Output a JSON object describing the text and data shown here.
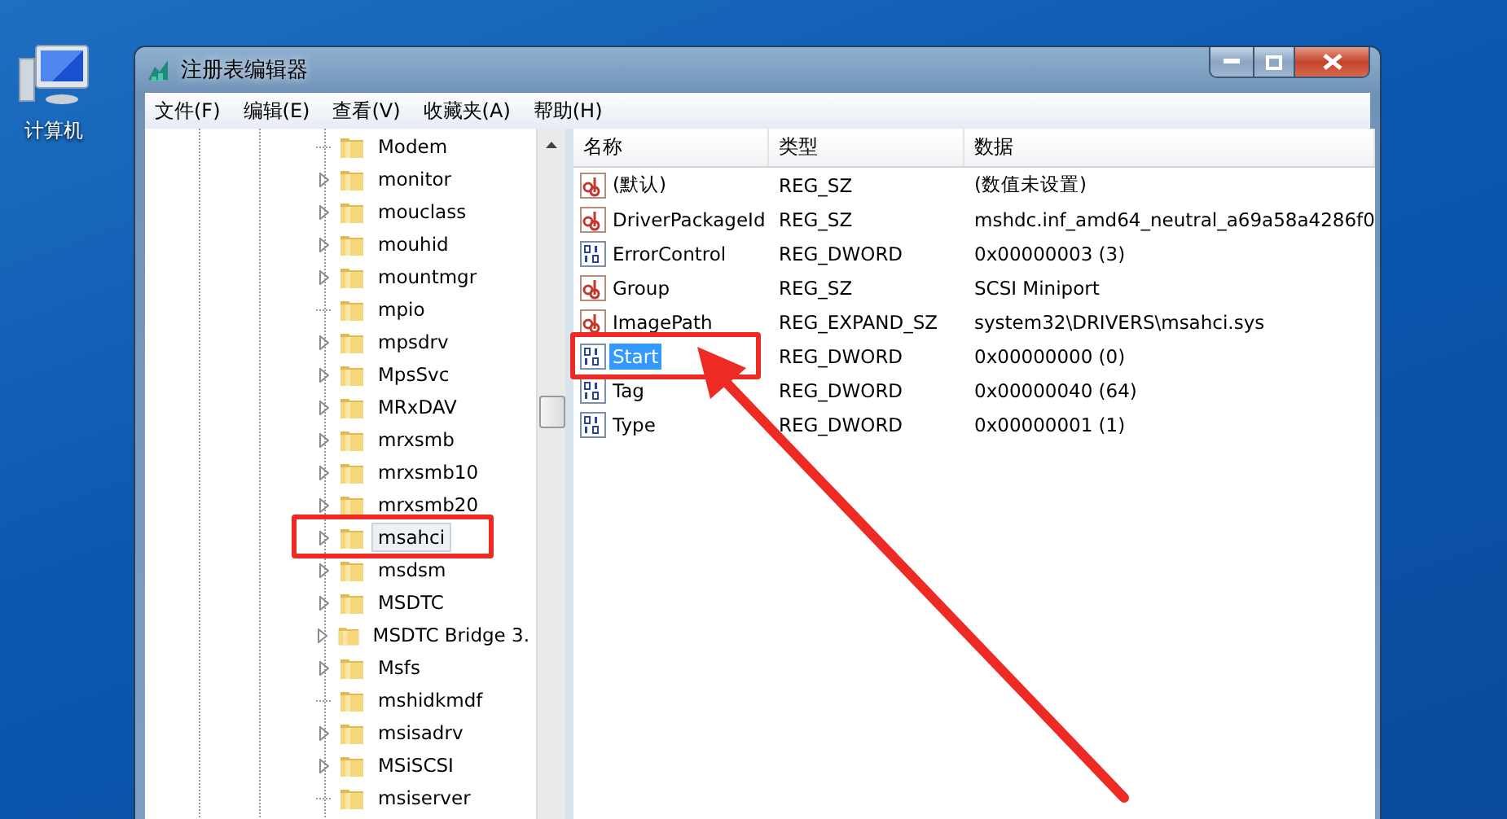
{
  "desktop_icons": [
    {
      "label": "计算机"
    }
  ],
  "window": {
    "title": "注册表编辑器"
  },
  "menu": [
    "文件(F)",
    "编辑(E)",
    "查看(V)",
    "收藏夹(A)",
    "帮助(H)"
  ],
  "tree": [
    {
      "label": "Modem",
      "kind": "leaf",
      "selected": false
    },
    {
      "label": "monitor",
      "kind": "expandable",
      "selected": false
    },
    {
      "label": "mouclass",
      "kind": "expandable",
      "selected": false
    },
    {
      "label": "mouhid",
      "kind": "expandable",
      "selected": false
    },
    {
      "label": "mountmgr",
      "kind": "expandable",
      "selected": false
    },
    {
      "label": "mpio",
      "kind": "leaf",
      "selected": false
    },
    {
      "label": "mpsdrv",
      "kind": "expandable",
      "selected": false
    },
    {
      "label": "MpsSvc",
      "kind": "expandable",
      "selected": false
    },
    {
      "label": "MRxDAV",
      "kind": "expandable",
      "selected": false
    },
    {
      "label": "mrxsmb",
      "kind": "expandable",
      "selected": false
    },
    {
      "label": "mrxsmb10",
      "kind": "expandable",
      "selected": false
    },
    {
      "label": "mrxsmb20",
      "kind": "expandable",
      "selected": false
    },
    {
      "label": "msahci",
      "kind": "expandable",
      "selected": true
    },
    {
      "label": "msdsm",
      "kind": "expandable",
      "selected": false
    },
    {
      "label": "MSDTC",
      "kind": "expandable",
      "selected": false
    },
    {
      "label": "MSDTC Bridge 3.",
      "kind": "expandable",
      "selected": false
    },
    {
      "label": "Msfs",
      "kind": "expandable",
      "selected": false
    },
    {
      "label": "mshidkmdf",
      "kind": "leaf",
      "selected": false
    },
    {
      "label": "msisadrv",
      "kind": "expandable",
      "selected": false
    },
    {
      "label": "MSiSCSI",
      "kind": "expandable",
      "selected": false
    },
    {
      "label": "msiserver",
      "kind": "leaf",
      "selected": false
    }
  ],
  "table": {
    "columns": [
      "名称",
      "类型",
      "数据"
    ],
    "rows": [
      {
        "name": "(默认)",
        "type": "REG_SZ",
        "data": "(数值未设置)",
        "kind": "string",
        "selected": false
      },
      {
        "name": "DriverPackageId",
        "type": "REG_SZ",
        "data": "mshdc.inf_amd64_neutral_a69a58a4286f0",
        "kind": "string",
        "selected": false
      },
      {
        "name": "ErrorControl",
        "type": "REG_DWORD",
        "data": "0x00000003 (3)",
        "kind": "binary",
        "selected": false
      },
      {
        "name": "Group",
        "type": "REG_SZ",
        "data": "SCSI Miniport",
        "kind": "string",
        "selected": false
      },
      {
        "name": "ImagePath",
        "type": "REG_EXPAND_SZ",
        "data": "system32\\DRIVERS\\msahci.sys",
        "kind": "string",
        "selected": false
      },
      {
        "name": "Start",
        "type": "REG_DWORD",
        "data": "0x00000000 (0)",
        "kind": "binary",
        "selected": true
      },
      {
        "name": "Tag",
        "type": "REG_DWORD",
        "data": "0x00000040 (64)",
        "kind": "binary",
        "selected": false
      },
      {
        "name": "Type",
        "type": "REG_DWORD",
        "data": "0x00000001 (1)",
        "kind": "binary",
        "selected": false
      }
    ]
  }
}
